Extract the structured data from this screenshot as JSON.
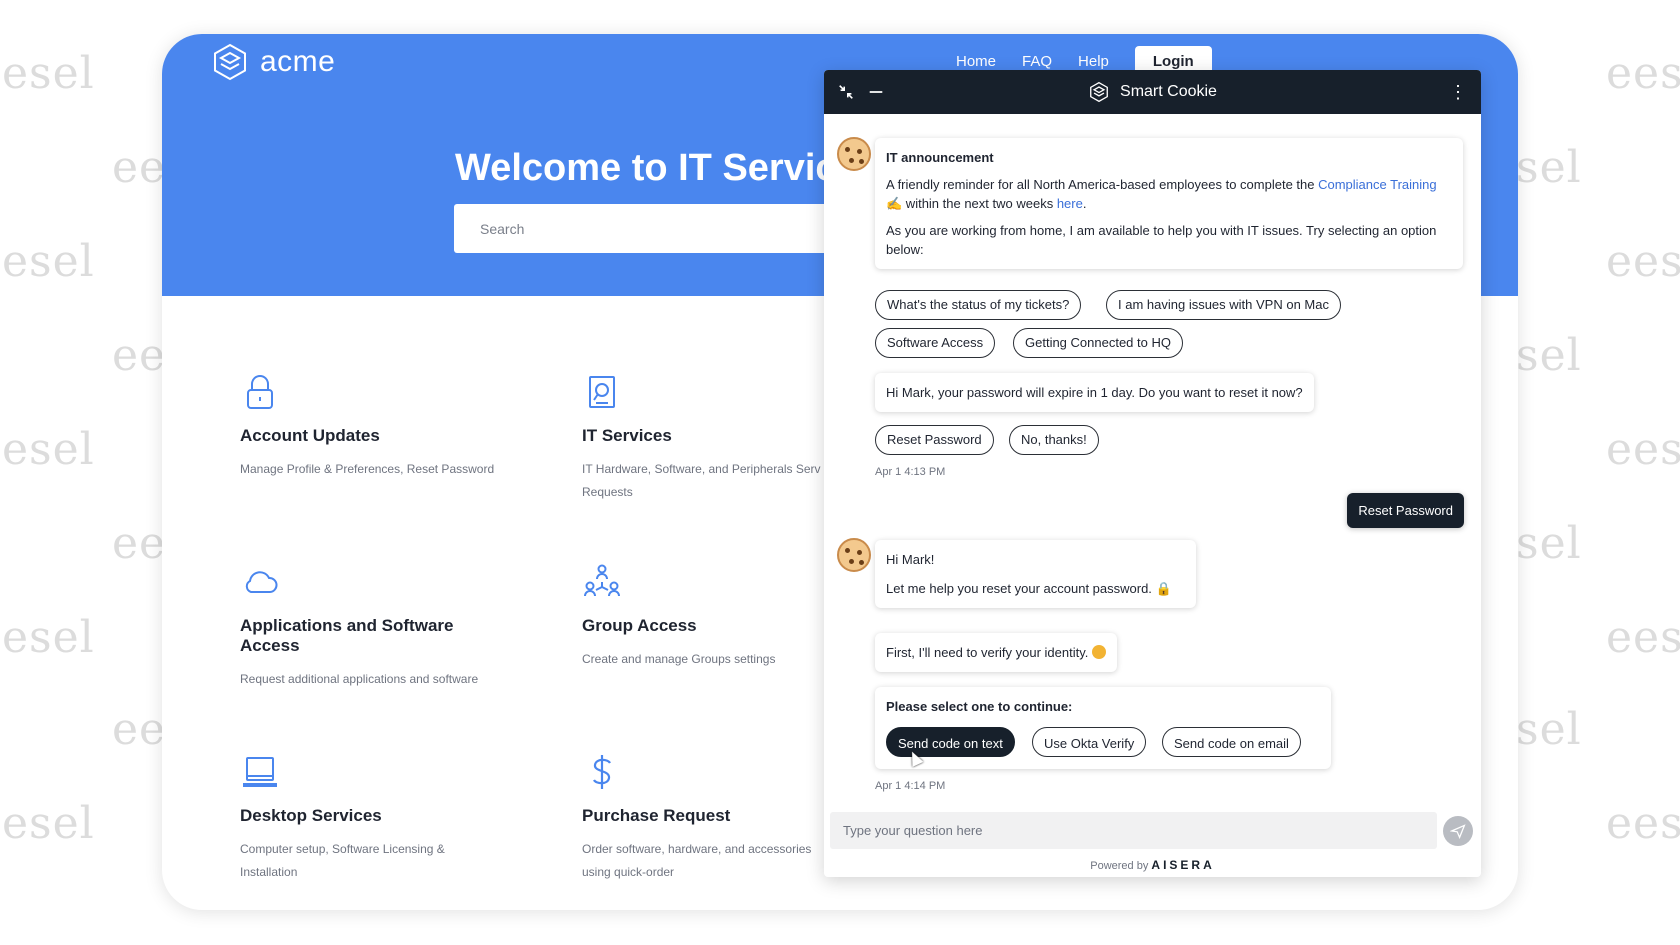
{
  "watermark": {
    "text_a": "esel",
    "text_b": "eese",
    "text_c": "ees",
    "text_d": "sel"
  },
  "site": {
    "brand": "acme",
    "nav": {
      "home": "Home",
      "faq": "FAQ",
      "help": "Help",
      "login": "Login"
    },
    "hero_title": "Welcome to IT Servic",
    "search_placeholder": "Search",
    "accent_color": "#4a86ee"
  },
  "cards": [
    {
      "icon": "lock-icon",
      "title": "Account Updates",
      "desc": "Manage Profile & Preferences, Reset Password"
    },
    {
      "icon": "it-services-icon",
      "title": "IT Services",
      "desc": "IT Hardware, Software, and Peripherals Serv Requests"
    },
    {
      "icon": "cloud-icon",
      "title": "Applications and Software Access",
      "desc": "Request additional applications and software"
    },
    {
      "icon": "group-icon",
      "title": "Group Access",
      "desc": "Create and manage Groups settings"
    },
    {
      "icon": "laptop-icon",
      "title": "Desktop Services",
      "desc": "Computer setup, Software Licensing & Installation"
    },
    {
      "icon": "dollar-icon",
      "title": "Purchase Request",
      "desc": "Order software, hardware, and accessories using quick-order"
    }
  ],
  "chat": {
    "title": "Smart Cookie",
    "announcement": {
      "heading": "IT announcement",
      "line1_pre": "A friendly reminder for all North America-based employees to complete the ",
      "link_text": "Compliance Training",
      "line1_post": " within the next two weeks ",
      "here": "here",
      "line2": "As you are working from home, I am available to help you with IT issues. Try selecting an option below:"
    },
    "quick_options": [
      "What's the status of my tickets?",
      "I am having issues with VPN on Mac",
      "Software Access",
      "Getting Connected to HQ"
    ],
    "password_prompt": "Hi Mark, your password will expire in 1 day. Do you want to reset it now?",
    "password_options": [
      "Reset Password",
      "No, thanks!"
    ],
    "time1": "Apr 1 4:13 PM",
    "user_reply": "Reset Password",
    "greet1": "Hi Mark!",
    "greet2": "Let me help you reset your account password.",
    "verify": "First, I'll need to verify your identity.",
    "select_heading": "Please select one to continue:",
    "verify_options": [
      "Send code on text",
      "Use Okta Verify",
      "Send code on email"
    ],
    "time2": "Apr 1 4:14 PM",
    "composer_placeholder": "Type your question here",
    "powered_by": "Powered by",
    "powered_brand": "AISERA"
  }
}
